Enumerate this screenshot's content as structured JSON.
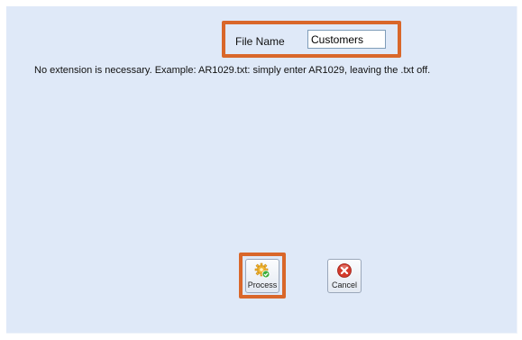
{
  "form": {
    "file_name_label": "File Name",
    "file_name_value": "Customers",
    "hint": "No extension is necessary.  Example: AR1029.txt: simply enter AR1029, leaving the .txt off."
  },
  "buttons": {
    "process_label": "Process",
    "process_icon": "gear-check-icon",
    "cancel_label": "Cancel",
    "cancel_icon": "red-x-circle-icon"
  },
  "colors": {
    "panel_background": "#dfe9f8",
    "highlight_border": "#d9672a"
  }
}
